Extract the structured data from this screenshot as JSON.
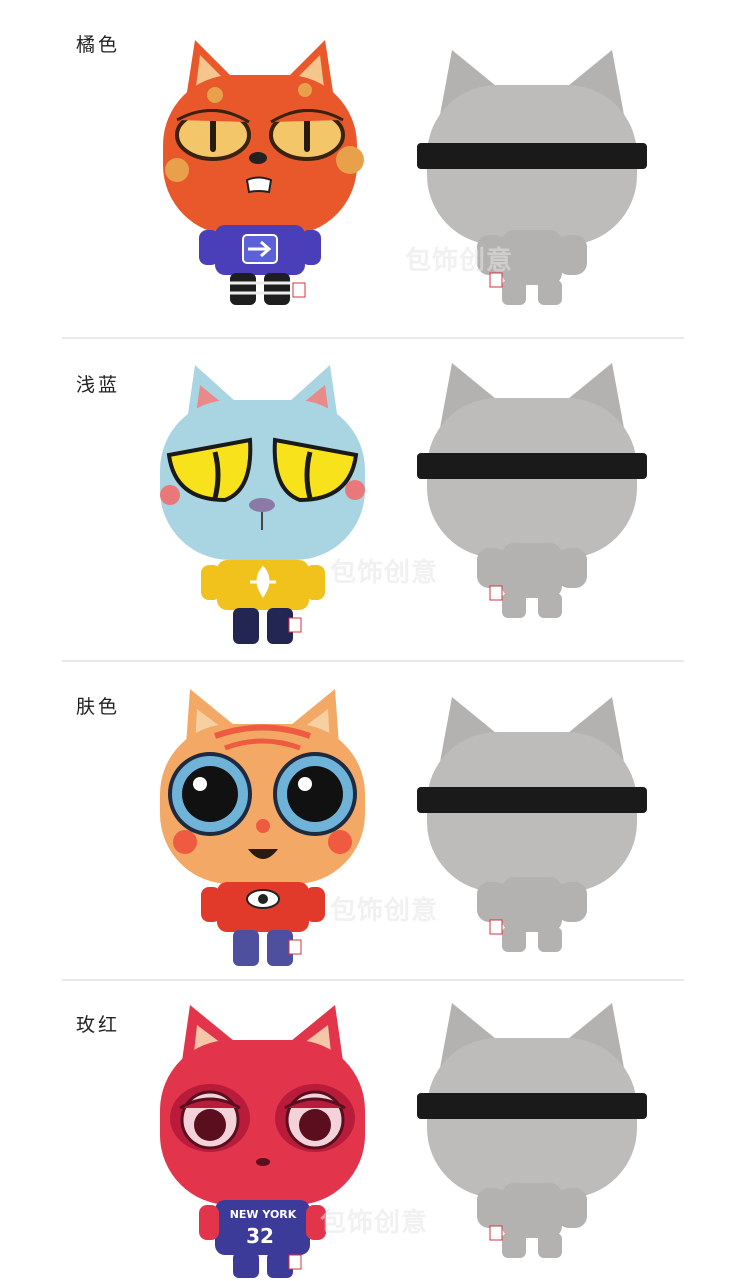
{
  "variants": [
    {
      "label": "橘色",
      "head": "#e8582a",
      "ear_inner": "#f4c58d",
      "spots": "#e9a04a",
      "eye": "#f4c66a",
      "shirt": "#4a3fb8",
      "pants": "#1e1e1e",
      "front_design": "arrow-sign"
    },
    {
      "label": "浅蓝",
      "head": "#a9d5e2",
      "ear_inner": "#e98a8a",
      "spots": "#e9787a",
      "eye": "#f7e21c",
      "shirt": "#f1c21c",
      "pants": "#232653",
      "front_design": "fleur-de-lis"
    },
    {
      "label": "肤色",
      "head": "#f3a965",
      "ear_inner": "#f6d0a0",
      "spots": "#ee5b40",
      "eye": "#6fb3d9",
      "shirt": "#e23a2a",
      "pants": "#4f4fa0",
      "front_design": "eye-emblem"
    },
    {
      "label": "玫红",
      "head": "#e2344a",
      "ear_inner": "#f5c6a8",
      "spots": "#b81c3a",
      "eye": "#f3d2da",
      "shirt": "#3d3b9a",
      "pants": "#3d3b9a",
      "front_design": "jersey",
      "jersey_text": "NEW YORK",
      "jersey_number": "32"
    }
  ],
  "back_view": {
    "body": "#bdbcba",
    "strap": "#1a1a1a",
    "tag": "#d4333d"
  },
  "watermark": "包饰创意"
}
